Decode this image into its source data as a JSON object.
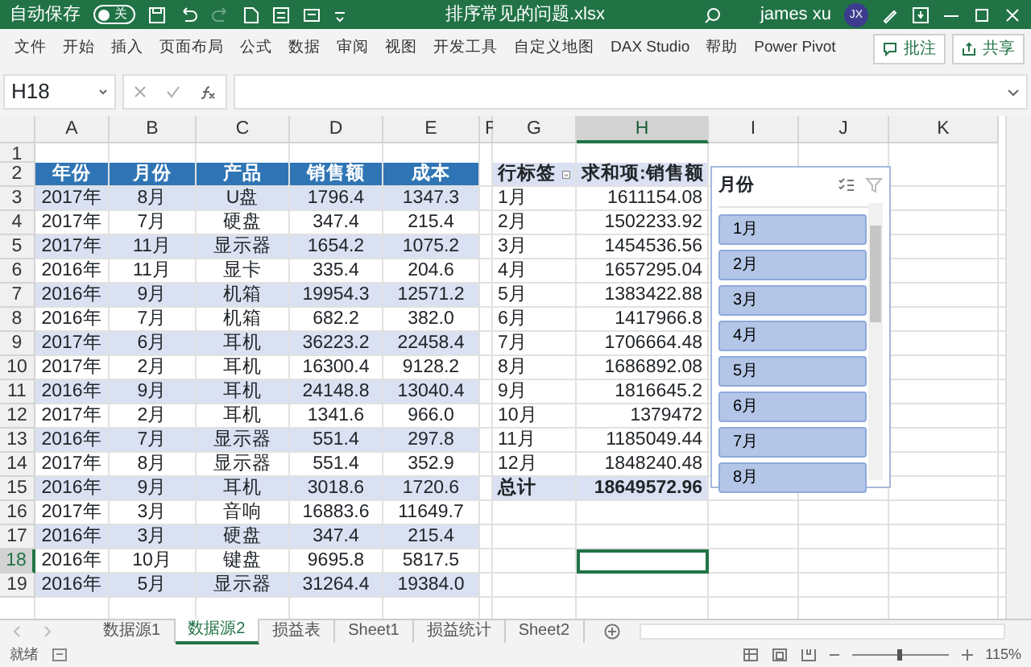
{
  "title_bar": {
    "autosave_label": "自动保存",
    "autosave_switch": {
      "label": "关",
      "on": false
    },
    "file_name": "排序常见的问题.xlsx",
    "user_name": "james xu",
    "avatar_initials": "JX"
  },
  "ribbon_tabs": [
    {
      "label": "文件"
    },
    {
      "label": "开始"
    },
    {
      "label": "插入"
    },
    {
      "label": "页面布局"
    },
    {
      "label": "公式"
    },
    {
      "label": "数据"
    },
    {
      "label": "审阅"
    },
    {
      "label": "视图"
    },
    {
      "label": "开发工具"
    },
    {
      "label": "自定义地图"
    },
    {
      "label": "DAX Studio"
    },
    {
      "label": "帮助"
    },
    {
      "label": "Power Pivot"
    }
  ],
  "ribbon_buttons": [
    {
      "kind": "comment",
      "label": "批注"
    },
    {
      "kind": "share",
      "label": "共享"
    }
  ],
  "name_box": "H18",
  "column_headers": [
    {
      "label": "A",
      "selected": false
    },
    {
      "label": "B",
      "selected": false
    },
    {
      "label": "C",
      "selected": false
    },
    {
      "label": "D",
      "selected": false
    },
    {
      "label": "E",
      "selected": false
    },
    {
      "label": "F",
      "selected": false
    },
    {
      "label": "G",
      "selected": false
    },
    {
      "label": "H",
      "selected": true
    },
    {
      "label": "I",
      "selected": false
    },
    {
      "label": "J",
      "selected": false
    },
    {
      "label": "K",
      "selected": false
    }
  ],
  "row_headers": [
    {
      "label": "1",
      "selected": false
    },
    {
      "label": "2",
      "selected": false
    },
    {
      "label": "3",
      "selected": false
    },
    {
      "label": "4",
      "selected": false
    },
    {
      "label": "5",
      "selected": false
    },
    {
      "label": "6",
      "selected": false
    },
    {
      "label": "7",
      "selected": false
    },
    {
      "label": "8",
      "selected": false
    },
    {
      "label": "9",
      "selected": false
    },
    {
      "label": "10",
      "selected": false
    },
    {
      "label": "11",
      "selected": false
    },
    {
      "label": "12",
      "selected": false
    },
    {
      "label": "13",
      "selected": false
    },
    {
      "label": "14",
      "selected": false
    },
    {
      "label": "15",
      "selected": false
    },
    {
      "label": "16",
      "selected": false
    },
    {
      "label": "17",
      "selected": false
    },
    {
      "label": "18",
      "selected": true
    },
    {
      "label": "19",
      "selected": false
    }
  ],
  "table": {
    "columns": [
      "年份",
      "月份",
      "产品",
      "销售额",
      "成本"
    ],
    "rows": [
      [
        "2017年",
        "8月",
        "U盘",
        "1796.4",
        "1347.3"
      ],
      [
        "2017年",
        "7月",
        "硬盘",
        "347.4",
        "215.4"
      ],
      [
        "2017年",
        "11月",
        "显示器",
        "1654.2",
        "1075.2"
      ],
      [
        "2016年",
        "11月",
        "显卡",
        "335.4",
        "204.6"
      ],
      [
        "2016年",
        "9月",
        "机箱",
        "19954.3",
        "12571.2"
      ],
      [
        "2016年",
        "7月",
        "机箱",
        "682.2",
        "382.0"
      ],
      [
        "2017年",
        "6月",
        "耳机",
        "36223.2",
        "22458.4"
      ],
      [
        "2017年",
        "2月",
        "耳机",
        "16300.4",
        "9128.2"
      ],
      [
        "2016年",
        "9月",
        "耳机",
        "24148.8",
        "13040.4"
      ],
      [
        "2017年",
        "2月",
        "耳机",
        "1341.6",
        "966.0"
      ],
      [
        "2016年",
        "7月",
        "显示器",
        "551.4",
        "297.8"
      ],
      [
        "2017年",
        "8月",
        "显示器",
        "551.4",
        "352.9"
      ],
      [
        "2016年",
        "9月",
        "耳机",
        "3018.6",
        "1720.6"
      ],
      [
        "2017年",
        "3月",
        "音响",
        "16883.6",
        "11649.7"
      ],
      [
        "2016年",
        "3月",
        "硬盘",
        "347.4",
        "215.4"
      ],
      [
        "2016年",
        "10月",
        "键盘",
        "9695.8",
        "5817.5"
      ],
      [
        "2016年",
        "5月",
        "显示器",
        "31264.4",
        "19384.0"
      ]
    ]
  },
  "pivot": {
    "columns": [
      "行标签",
      "求和项:销售额"
    ],
    "rows": [
      [
        "1月",
        "1611154.08"
      ],
      [
        "2月",
        "1502233.92"
      ],
      [
        "3月",
        "1454536.56"
      ],
      [
        "4月",
        "1657295.04"
      ],
      [
        "5月",
        "1383422.88"
      ],
      [
        "6月",
        "1417966.8"
      ],
      [
        "7月",
        "1706664.48"
      ],
      [
        "8月",
        "1686892.08"
      ],
      [
        "9月",
        "1816645.2"
      ],
      [
        "10月",
        "1379472"
      ],
      [
        "11月",
        "1185049.44"
      ],
      [
        "12月",
        "1848240.48"
      ]
    ],
    "total": [
      "总计",
      "18649572.96"
    ]
  },
  "slicer": {
    "title": "月份",
    "items": [
      {
        "label": "1月",
        "selected": true
      },
      {
        "label": "2月",
        "selected": true
      },
      {
        "label": "3月",
        "selected": true
      },
      {
        "label": "4月",
        "selected": true
      },
      {
        "label": "5月",
        "selected": true
      },
      {
        "label": "6月",
        "selected": true
      },
      {
        "label": "7月",
        "selected": true
      },
      {
        "label": "8月",
        "selected": true
      }
    ]
  },
  "sheet_tabs": [
    {
      "label": "数据源1",
      "selected": false
    },
    {
      "label": "数据源2",
      "selected": true
    },
    {
      "label": "损益表",
      "selected": false
    },
    {
      "label": "Sheet1",
      "selected": false
    },
    {
      "label": "损益统计",
      "selected": false
    },
    {
      "label": "Sheet2",
      "selected": false
    }
  ],
  "status_bar": {
    "status": "就绪",
    "zoom": {
      "label": "115%",
      "level": 0.5
    }
  }
}
